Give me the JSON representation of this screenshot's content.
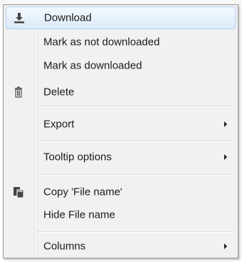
{
  "menu": {
    "items": [
      {
        "label": "Download",
        "icon": "download-icon"
      },
      {
        "label": "Mark as not downloaded"
      },
      {
        "label": "Mark as downloaded"
      },
      {
        "label": "Delete",
        "icon": "trash-icon"
      },
      {
        "label": "Export",
        "submenu": true
      },
      {
        "label": "Tooltip options",
        "submenu": true
      },
      {
        "label": "Copy 'File name'",
        "icon": "copy-icon"
      },
      {
        "label": "Hide  File name"
      },
      {
        "label": "Columns",
        "submenu": true
      }
    ],
    "colors": {
      "highlight_border": "#aecff7",
      "icon": "#444444"
    }
  }
}
